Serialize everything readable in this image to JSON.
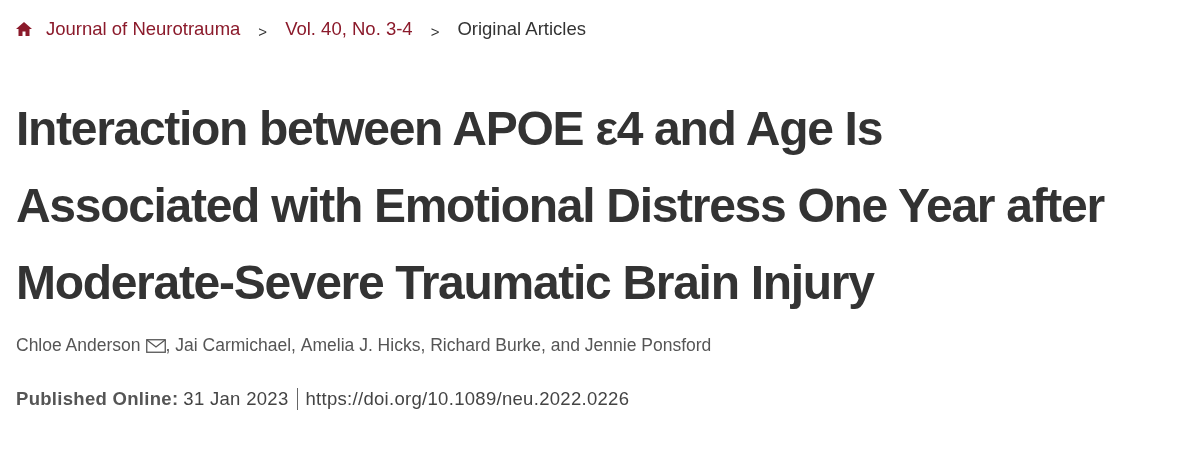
{
  "breadcrumbs": [
    {
      "kind": "home",
      "label": "Journal of Neurotrauma"
    },
    {
      "kind": "separator",
      "label": ">"
    },
    {
      "kind": "link",
      "label": "Vol. 40, No. 3-4"
    },
    {
      "kind": "separator",
      "label": ">"
    },
    {
      "kind": "current",
      "label": "Original Articles"
    }
  ],
  "title_lines": [
    "Interaction between APOE ε4 and Age Is",
    "Associated with Emotional Distress One Year after",
    "Moderate-Severe Traumatic Brain Injury"
  ],
  "authors": [
    {
      "name": "Chloe Anderson",
      "email": true,
      "suffix": ","
    },
    {
      "name": "Jai Carmichael",
      "email": false,
      "suffix": ","
    },
    {
      "name": "Amelia J. Hicks",
      "email": false,
      "suffix": ","
    },
    {
      "name": "Richard Burke",
      "email": false,
      "suffix": ", and"
    },
    {
      "name": "Jennie Ponsford",
      "email": false
    }
  ],
  "published": {
    "label": "Published Online:",
    "date": "31 Jan 2023",
    "doi": "https://doi.org/10.1089/neu.2022.0226"
  }
}
